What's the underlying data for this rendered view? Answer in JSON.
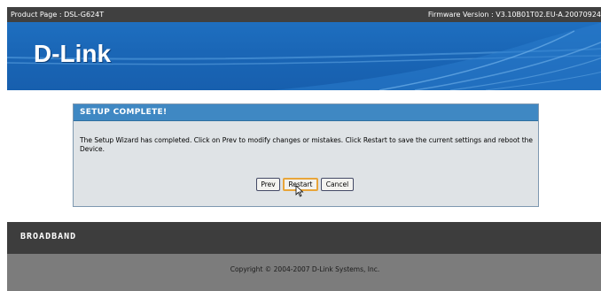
{
  "topbar": {
    "product": "Product Page : DSL-G624T",
    "firmware": "Firmware Version : V3.10B01T02.EU-A.20070924"
  },
  "banner": {
    "logo": "D-Link"
  },
  "setup": {
    "title": "SETUP COMPLETE!",
    "message": "The Setup Wizard has completed. Click on Prev to modify changes or mistakes. Click Restart to save the current settings and reboot the Device.",
    "buttons": {
      "prev": "Prev",
      "restart": "Restart",
      "cancel": "Cancel"
    }
  },
  "brand_strip": {
    "label": "BROADBAND"
  },
  "footer": {
    "copyright": "Copyright © 2004-2007 D-Link Systems, Inc."
  },
  "colors": {
    "banner_blue": "#1a66b6",
    "panel_header": "#3f88c3",
    "panel_body": "#dfe3e6",
    "dark_strip": "#3d3d3d",
    "footer_gray": "#7c7c7c",
    "button_focus": "#e8a53a"
  },
  "icons": {
    "cursor": "mouse-pointer-icon"
  }
}
